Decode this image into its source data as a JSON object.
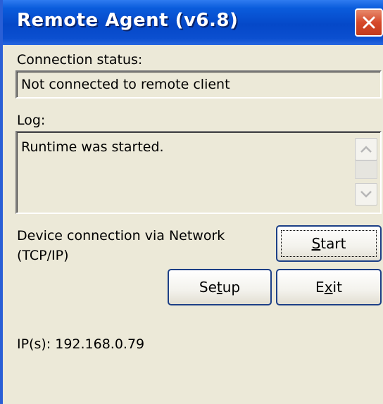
{
  "window": {
    "title": "Remote Agent (v6.8)",
    "close_icon": "close-icon"
  },
  "connection": {
    "label": "Connection status:",
    "value": "Not connected to remote client"
  },
  "log": {
    "label": "Log:",
    "text": "Runtime was started.",
    "scroll_up_icon": "chevron-up-icon",
    "scroll_down_icon": "chevron-down-icon"
  },
  "device": {
    "line1": "Device connection via Network",
    "line2": "(TCP/IP)"
  },
  "buttons": {
    "start": {
      "pre": "",
      "mnemonic": "S",
      "post": "tart"
    },
    "setup": {
      "pre": "Se",
      "mnemonic": "t",
      "post": "up"
    },
    "exit": {
      "pre": "E",
      "mnemonic": "x",
      "post": "it"
    }
  },
  "ip": {
    "text": "IP(s): 192.168.0.79"
  },
  "colors": {
    "titlebar": "#0548c8",
    "close_button": "#d6492a",
    "window_bg": "#ece9d8",
    "button_border": "#1c3f86"
  }
}
